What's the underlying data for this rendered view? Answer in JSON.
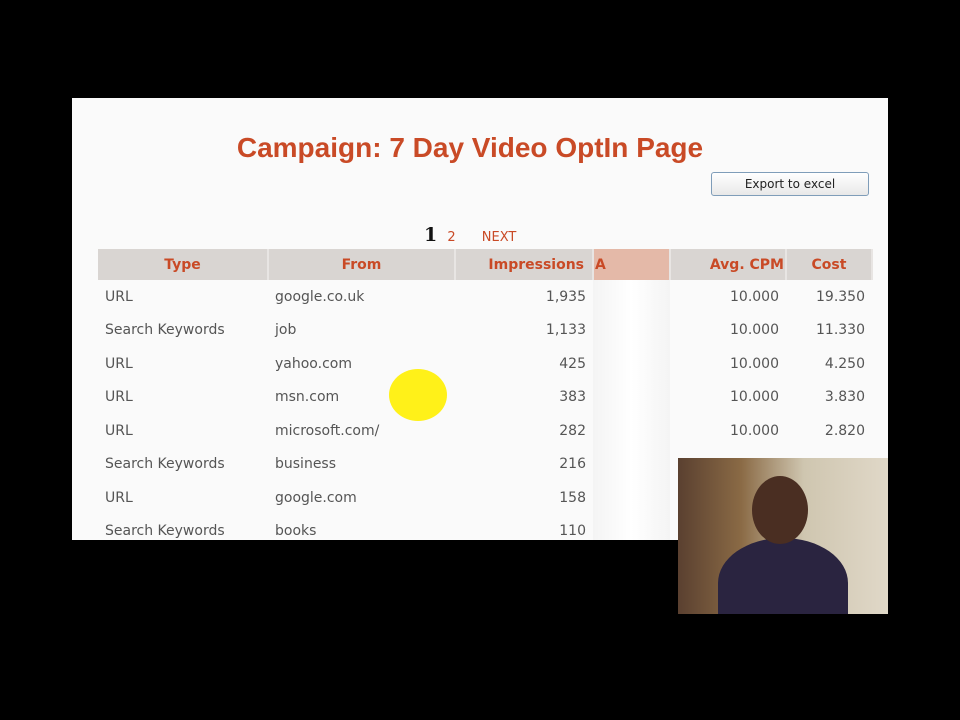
{
  "title": "Campaign: 7 Day Video OptIn Page",
  "export_label": "Export to excel",
  "pagination": {
    "current": "1",
    "pages": [
      "2"
    ],
    "next": "NEXT"
  },
  "columns": [
    "Type",
    "From",
    "Impressions",
    "A",
    "Avg. CPM",
    "Cost"
  ],
  "rows": [
    [
      "URL",
      "google.co.uk",
      "1,935",
      "",
      "10.000",
      "19.350"
    ],
    [
      "Search Keywords",
      "job",
      "1,133",
      "",
      "10.000",
      "11.330"
    ],
    [
      "URL",
      "yahoo.com",
      "425",
      "",
      "10.000",
      "4.250"
    ],
    [
      "URL",
      "msn.com",
      "383",
      "",
      "10.000",
      "3.830"
    ],
    [
      "URL",
      "microsoft.com/",
      "282",
      "",
      "10.000",
      "2.820"
    ],
    [
      "Search Keywords",
      "business",
      "216",
      "",
      "",
      ""
    ],
    [
      "URL",
      "google.com",
      "158",
      "",
      "",
      ""
    ],
    [
      "Search Keywords",
      "books",
      "110",
      "",
      "",
      ""
    ]
  ]
}
